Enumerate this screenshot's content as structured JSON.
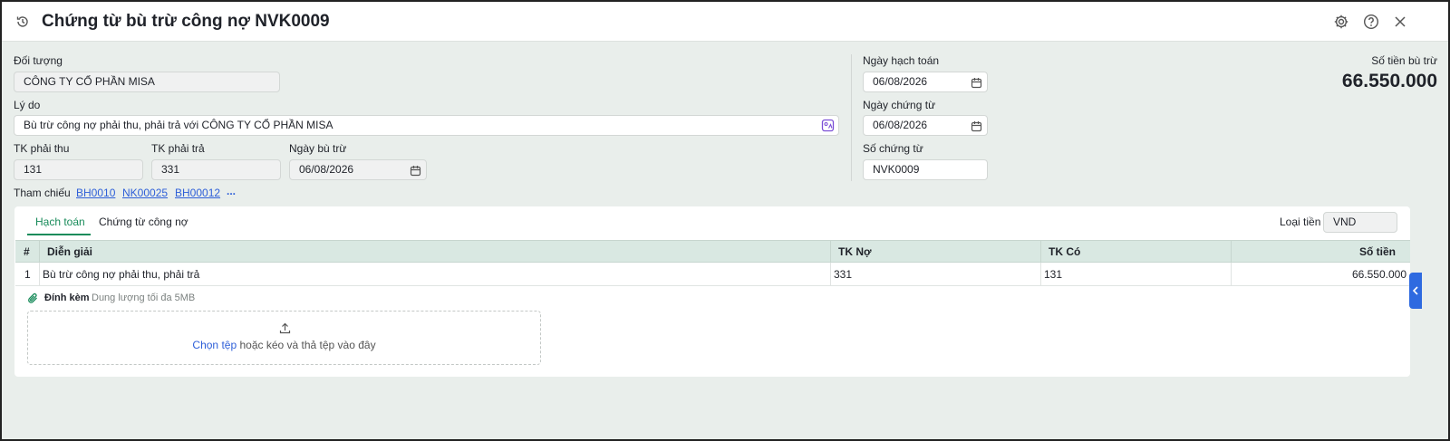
{
  "header": {
    "title": "Chứng từ bù trừ công nợ NVK0009",
    "icons": [
      "history-icon",
      "settings-icon",
      "help-icon",
      "close-icon"
    ]
  },
  "form": {
    "doi_tuong_label": "Đối tượng",
    "doi_tuong_value": "CÔNG TY CỔ PHẦN MISA",
    "ly_do_label": "Lý do",
    "ly_do_value": "Bù trừ công nợ phải thu, phải trả với CÔNG TY CỔ PHẦN MISA",
    "tk_phai_thu_label": "TK phải thu",
    "tk_phai_thu_value": "131",
    "tk_phai_tra_label": "TK phải trả",
    "tk_phai_tra_value": "331",
    "ngay_bu_tru_label": "Ngày bù trừ",
    "ngay_bu_tru_value": "06/08/2026",
    "ngay_hach_toan_label": "Ngày hạch toán",
    "ngay_hach_toan_value": "06/08/2026",
    "ngay_chung_tu_label": "Ngày chứng từ",
    "ngay_chung_tu_value": "06/08/2026",
    "so_chung_tu_label": "Số chứng từ",
    "so_chung_tu_value": "NVK0009",
    "so_tien_label": "Số tiền bù trừ",
    "so_tien_value": "66.550.000"
  },
  "references": {
    "label": "Tham chiếu",
    "links": [
      "BH0010",
      "NK00025",
      "BH00012"
    ],
    "more": "..."
  },
  "tabs": {
    "items": [
      "Hạch toán",
      "Chứng từ công nợ"
    ],
    "active": "Hạch toán",
    "currency_label": "Loại tiền",
    "currency_value": "VND"
  },
  "table": {
    "columns": [
      "#",
      "Diễn giải",
      "TK Nợ",
      "TK Có",
      "Số tiền"
    ],
    "rows": [
      [
        "1",
        "Bù trừ công nợ phải thu, phải trả",
        "331",
        "131",
        "66.550.000"
      ]
    ]
  },
  "attachment": {
    "label": "Đính kèm",
    "hint": "Dung lượng tối đa 5MB",
    "choose_link": "Chọn tệp",
    "drop_text": "hoặc kéo và thả tệp vào đây"
  },
  "colors": {
    "accent_green": "#188b5a",
    "link_blue": "#2e5fd8",
    "side_tab_blue": "#2e6ae0",
    "background": "#e9eeeb"
  }
}
